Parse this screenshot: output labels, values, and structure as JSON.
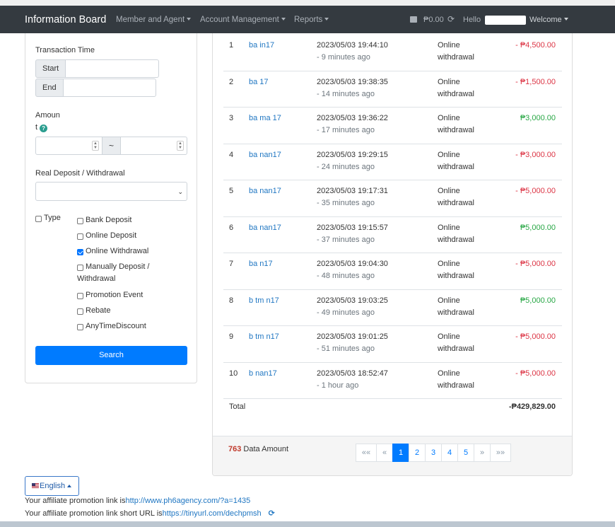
{
  "navbar": {
    "brand": "Information Board",
    "menus": [
      "Member and Agent",
      "Account Management",
      "Reports"
    ],
    "balance": "₱0.00",
    "greeting": "Hello",
    "welcome": "Welcome"
  },
  "filters": {
    "transaction_time_label": "Transaction Time",
    "start_label": "Start",
    "end_label": "End",
    "amount_label_1": "Amoun",
    "amount_label_2": "t",
    "tilde": "~",
    "real_label": "Real Deposit / Withdrawal",
    "type_label": "Type",
    "types": [
      {
        "label": "Bank Deposit",
        "checked": false
      },
      {
        "label": "Online Deposit",
        "checked": false
      },
      {
        "label": "Online Withdrawal",
        "checked": true
      },
      {
        "label": "Manually Deposit /",
        "label2": "Withdrawal",
        "checked": false
      },
      {
        "label": "Promotion Event",
        "checked": false
      },
      {
        "label": "Rebate",
        "checked": false
      },
      {
        "label": "AnyTimeDiscount",
        "checked": false
      }
    ],
    "search_label": "Search"
  },
  "transactions": [
    {
      "no": "1",
      "user": "ba   in17",
      "time": "2023/05/03 19:44:10",
      "ago": "- 9 minutes ago",
      "type1": "Online",
      "type2": "withdrawal",
      "amount": "- ₱4,500.00",
      "sign": "neg"
    },
    {
      "no": "2",
      "user": "ba   17",
      "time": "2023/05/03 19:38:35",
      "ago": "- 14 minutes ago",
      "type1": "Online",
      "type2": "withdrawal",
      "amount": "- ₱1,500.00",
      "sign": "neg"
    },
    {
      "no": "3",
      "user": "ba  ma  17",
      "time": "2023/05/03 19:36:22",
      "ago": "- 17 minutes ago",
      "type1": "Online",
      "type2": "withdrawal",
      "amount": "₱3,000.00",
      "sign": "pos"
    },
    {
      "no": "4",
      "user": "ba  nan17",
      "time": "2023/05/03 19:29:15",
      "ago": "- 24 minutes ago",
      "type1": "Online",
      "type2": "withdrawal",
      "amount": "- ₱3,000.00",
      "sign": "neg"
    },
    {
      "no": "5",
      "user": "ba  nan17",
      "time": "2023/05/03 19:17:31",
      "ago": "- 35 minutes ago",
      "type1": "Online",
      "type2": "withdrawal",
      "amount": "- ₱5,000.00",
      "sign": "neg"
    },
    {
      "no": "6",
      "user": "ba  nan17",
      "time": "2023/05/03 19:15:57",
      "ago": "- 37 minutes ago",
      "type1": "Online",
      "type2": "withdrawal",
      "amount": "₱5,000.00",
      "sign": "pos"
    },
    {
      "no": "7",
      "user": "ba   n17",
      "time": "2023/05/03 19:04:30",
      "ago": "- 48 minutes ago",
      "type1": "Online",
      "type2": "withdrawal",
      "amount": "- ₱5,000.00",
      "sign": "neg"
    },
    {
      "no": "8",
      "user": "b  tm  n17",
      "time": "2023/05/03 19:03:25",
      "ago": "- 49 minutes ago",
      "type1": "Online",
      "type2": "withdrawal",
      "amount": "₱5,000.00",
      "sign": "pos"
    },
    {
      "no": "9",
      "user": "b  tm  n17",
      "time": "2023/05/03 19:01:25",
      "ago": "- 51 minutes ago",
      "type1": "Online",
      "type2": "withdrawal",
      "amount": "- ₱5,000.00",
      "sign": "neg"
    },
    {
      "no": "10",
      "user": "b   nan17",
      "time": "2023/05/03 18:52:47",
      "ago": "- 1 hour ago",
      "type1": "Online",
      "type2": "withdrawal",
      "amount": "- ₱5,000.00",
      "sign": "neg"
    }
  ],
  "total": {
    "label": "Total",
    "amount": "-₱429,829.00"
  },
  "footer": {
    "data_amount_count": "763",
    "data_amount_label": "Data Amount",
    "pages": [
      "««",
      "«",
      "1",
      "2",
      "3",
      "4",
      "5",
      "»",
      "»»"
    ],
    "active_page": "1"
  },
  "language": {
    "label": "English"
  },
  "affiliate": {
    "link_label": "Your affiliate promotion link is",
    "link_url": "http://www.ph6agency.com/?a=1435",
    "short_label": "Your affiliate promotion link short URL is",
    "short_url": "https://tinyurl.com/dechpmsh"
  },
  "colors": {
    "navbar": "#343a40",
    "primary": "#007bff",
    "negative": "#dc3545",
    "positive": "#28a745"
  }
}
